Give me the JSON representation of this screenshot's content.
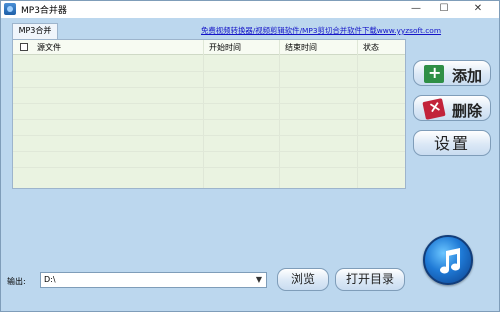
{
  "window": {
    "title": "MP3合并器",
    "controls": {
      "minimize": "—",
      "maximize": "☐",
      "close": "✕"
    }
  },
  "tab": {
    "label": "MP3合并"
  },
  "promo_link": "免费视频转换器/视频剪辑软件/MP3剪切合并软件下载www.yyzsoft.com",
  "file_list": {
    "columns": [
      "源文件",
      "开始时间",
      "结束时间",
      "状态"
    ],
    "rows": []
  },
  "side_buttons": {
    "add": "添加",
    "delete": "删除",
    "settings": "设置"
  },
  "output": {
    "label": "输出:",
    "value": "D:\\"
  },
  "bottom_buttons": {
    "browse": "浏览",
    "open_dir": "打开目录"
  },
  "icons": {
    "app": "app-icon",
    "add": "add-icon",
    "delete": "delete-icon",
    "music": "music-note-icon"
  },
  "colors": {
    "background": "#bcd7ee",
    "list_background": "#eaf3e1",
    "link": "#1515c8"
  }
}
